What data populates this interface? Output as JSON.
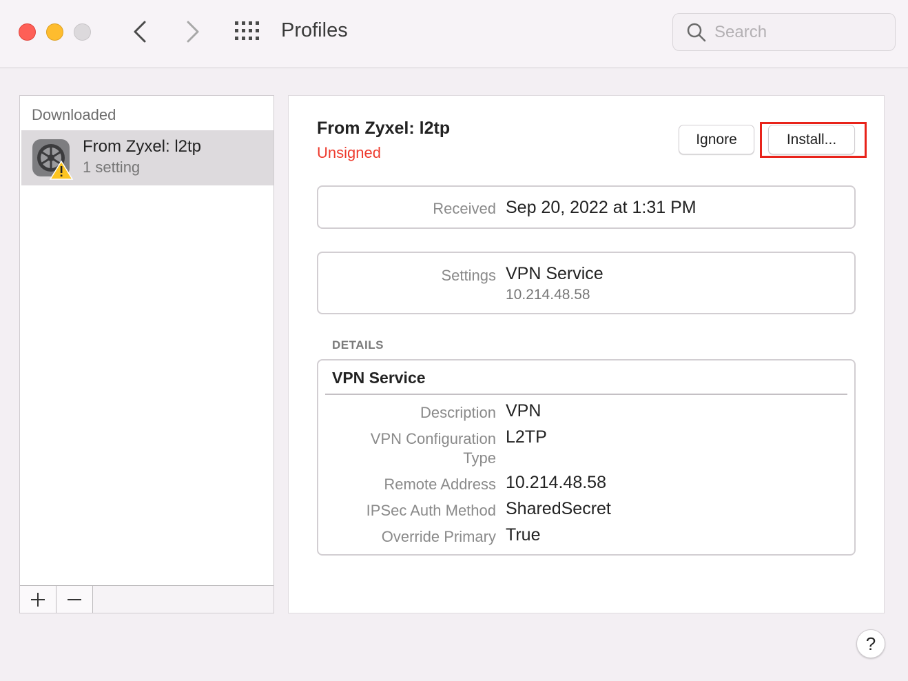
{
  "window": {
    "title": "Profiles",
    "search_placeholder": "Search"
  },
  "sidebar": {
    "header": "Downloaded",
    "items": [
      {
        "title": "From Zyxel: l2tp",
        "subtitle": "1 setting",
        "icon": "system-preferences-warning-icon"
      }
    ]
  },
  "detail": {
    "title": "From Zyxel: l2tp",
    "status": "Unsigned",
    "status_color": "#ee3b2e",
    "ignore_label": "Ignore",
    "install_label": "Install...",
    "received_label": "Received",
    "received_value": "Sep 20, 2022 at 1:31 PM",
    "settings_label": "Settings",
    "settings_value": "VPN Service",
    "settings_sub": "10.214.48.58",
    "details_header": "DETAILS",
    "details_title": "VPN Service",
    "rows": [
      {
        "label": "Description",
        "value": "VPN"
      },
      {
        "label": "VPN Configuration",
        "label2": "Type",
        "value": "L2TP"
      },
      {
        "label": "Remote Address",
        "value": "10.214.48.58"
      },
      {
        "label": "IPSec Auth Method",
        "value": "SharedSecret"
      },
      {
        "label": "Override Primary",
        "value": "True"
      }
    ]
  },
  "help_label": "?"
}
